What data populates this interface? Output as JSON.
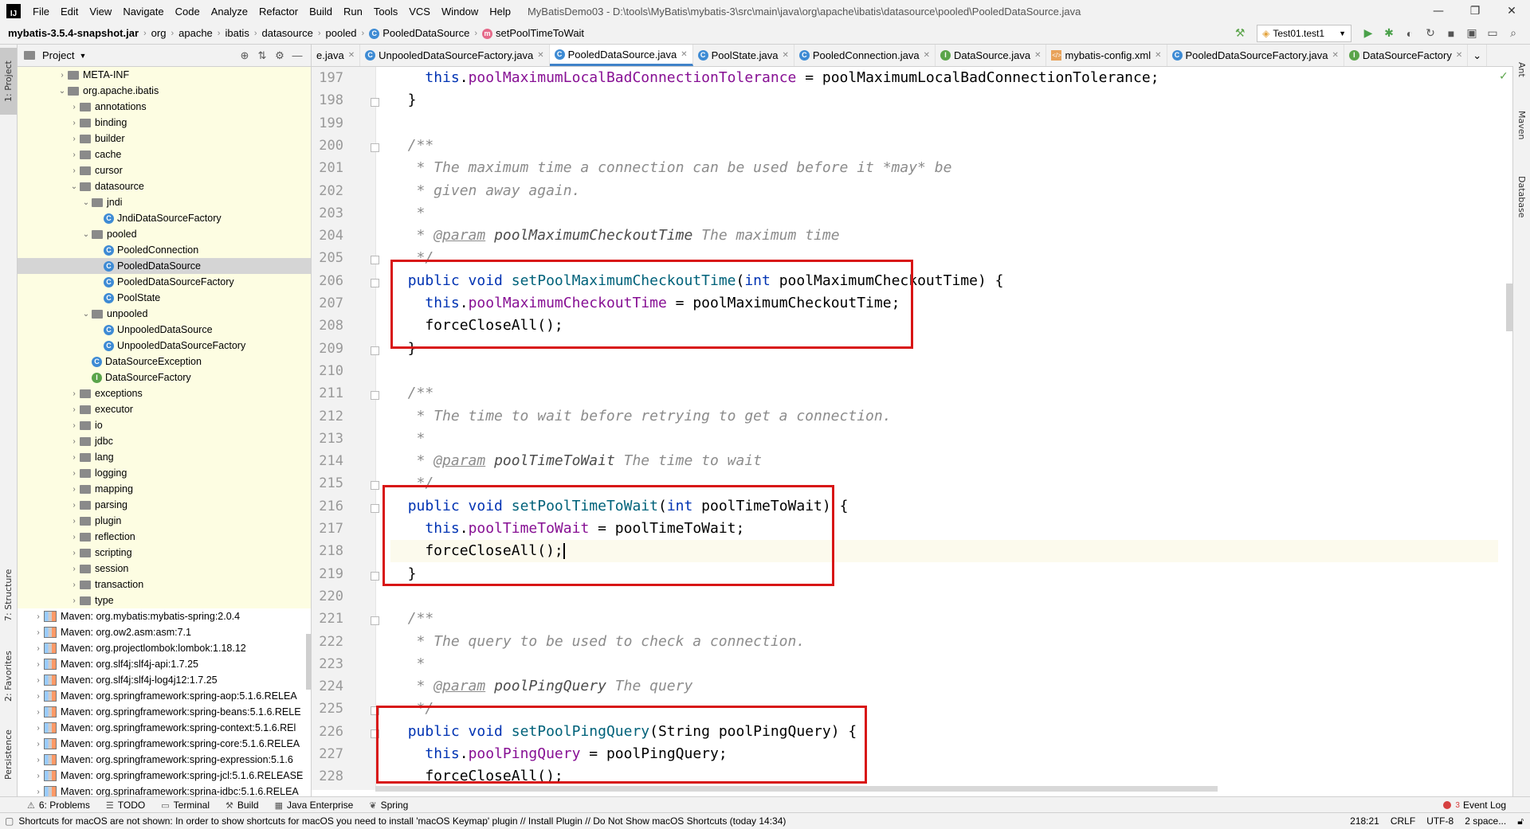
{
  "menubar": {
    "logo": "IJ",
    "items": [
      "File",
      "Edit",
      "View",
      "Navigate",
      "Code",
      "Analyze",
      "Refactor",
      "Build",
      "Run",
      "Tools",
      "VCS",
      "Window",
      "Help"
    ],
    "title": "MyBatisDemo03 - D:\\tools\\MyBatis\\mybatis-3\\src\\main\\java\\org\\apache\\ibatis\\datasource\\pooled\\PooledDataSource.java"
  },
  "breadcrumb": {
    "items": [
      "mybatis-3.5.4-snapshot.jar",
      "org",
      "apache",
      "ibatis",
      "datasource",
      "pooled",
      "PooledDataSource",
      "setPoolTimeToWait"
    ]
  },
  "run_config": {
    "label": "Test01.test1"
  },
  "stripes": {
    "left": [
      "1: Project",
      "7: Structure",
      "2: Favorites",
      "Persistence"
    ],
    "right": [
      "Ant",
      "Maven",
      "Database"
    ]
  },
  "project_panel": {
    "title": "Project",
    "tree": [
      {
        "label": "META-INF",
        "depth": 3,
        "icon": "folder",
        "arrow": "›"
      },
      {
        "label": "org.apache.ibatis",
        "depth": 3,
        "icon": "folder",
        "arrow": "⌄"
      },
      {
        "label": "annotations",
        "depth": 4,
        "icon": "folder",
        "arrow": "›"
      },
      {
        "label": "binding",
        "depth": 4,
        "icon": "folder",
        "arrow": "›"
      },
      {
        "label": "builder",
        "depth": 4,
        "icon": "folder",
        "arrow": "›"
      },
      {
        "label": "cache",
        "depth": 4,
        "icon": "folder",
        "arrow": "›"
      },
      {
        "label": "cursor",
        "depth": 4,
        "icon": "folder",
        "arrow": "›"
      },
      {
        "label": "datasource",
        "depth": 4,
        "icon": "folder",
        "arrow": "⌄"
      },
      {
        "label": "jndi",
        "depth": 5,
        "icon": "folder",
        "arrow": "⌄"
      },
      {
        "label": "JndiDataSourceFactory",
        "depth": 6,
        "icon": "class",
        "arrow": ""
      },
      {
        "label": "pooled",
        "depth": 5,
        "icon": "folder",
        "arrow": "⌄"
      },
      {
        "label": "PooledConnection",
        "depth": 6,
        "icon": "class",
        "arrow": ""
      },
      {
        "label": "PooledDataSource",
        "depth": 6,
        "icon": "class",
        "arrow": "",
        "selected": true
      },
      {
        "label": "PooledDataSourceFactory",
        "depth": 6,
        "icon": "class",
        "arrow": ""
      },
      {
        "label": "PoolState",
        "depth": 6,
        "icon": "class",
        "arrow": ""
      },
      {
        "label": "unpooled",
        "depth": 5,
        "icon": "folder",
        "arrow": "⌄"
      },
      {
        "label": "UnpooledDataSource",
        "depth": 6,
        "icon": "class",
        "arrow": ""
      },
      {
        "label": "UnpooledDataSourceFactory",
        "depth": 6,
        "icon": "class",
        "arrow": ""
      },
      {
        "label": "DataSourceException",
        "depth": 5,
        "icon": "class",
        "arrow": ""
      },
      {
        "label": "DataSourceFactory",
        "depth": 5,
        "icon": "interface",
        "arrow": ""
      },
      {
        "label": "exceptions",
        "depth": 4,
        "icon": "folder",
        "arrow": "›"
      },
      {
        "label": "executor",
        "depth": 4,
        "icon": "folder",
        "arrow": "›"
      },
      {
        "label": "io",
        "depth": 4,
        "icon": "folder",
        "arrow": "›"
      },
      {
        "label": "jdbc",
        "depth": 4,
        "icon": "folder",
        "arrow": "›"
      },
      {
        "label": "lang",
        "depth": 4,
        "icon": "folder",
        "arrow": "›"
      },
      {
        "label": "logging",
        "depth": 4,
        "icon": "folder",
        "arrow": "›"
      },
      {
        "label": "mapping",
        "depth": 4,
        "icon": "folder",
        "arrow": "›"
      },
      {
        "label": "parsing",
        "depth": 4,
        "icon": "folder",
        "arrow": "›"
      },
      {
        "label": "plugin",
        "depth": 4,
        "icon": "folder",
        "arrow": "›"
      },
      {
        "label": "reflection",
        "depth": 4,
        "icon": "folder",
        "arrow": "›"
      },
      {
        "label": "scripting",
        "depth": 4,
        "icon": "folder",
        "arrow": "›"
      },
      {
        "label": "session",
        "depth": 4,
        "icon": "folder",
        "arrow": "›"
      },
      {
        "label": "transaction",
        "depth": 4,
        "icon": "folder",
        "arrow": "›"
      },
      {
        "label": "type",
        "depth": 4,
        "icon": "folder",
        "arrow": "›"
      },
      {
        "label": "Maven: org.mybatis:mybatis-spring:2.0.4",
        "depth": 1,
        "icon": "lib",
        "arrow": "›",
        "plain": true
      },
      {
        "label": "Maven: org.ow2.asm:asm:7.1",
        "depth": 1,
        "icon": "lib",
        "arrow": "›",
        "plain": true
      },
      {
        "label": "Maven: org.projectlombok:lombok:1.18.12",
        "depth": 1,
        "icon": "lib",
        "arrow": "›",
        "plain": true
      },
      {
        "label": "Maven: org.slf4j:slf4j-api:1.7.25",
        "depth": 1,
        "icon": "lib",
        "arrow": "›",
        "plain": true
      },
      {
        "label": "Maven: org.slf4j:slf4j-log4j12:1.7.25",
        "depth": 1,
        "icon": "lib",
        "arrow": "›",
        "plain": true
      },
      {
        "label": "Maven: org.springframework:spring-aop:5.1.6.RELEA",
        "depth": 1,
        "icon": "lib",
        "arrow": "›",
        "plain": true
      },
      {
        "label": "Maven: org.springframework:spring-beans:5.1.6.RELE",
        "depth": 1,
        "icon": "lib",
        "arrow": "›",
        "plain": true
      },
      {
        "label": "Maven: org.springframework:spring-context:5.1.6.REl",
        "depth": 1,
        "icon": "lib",
        "arrow": "›",
        "plain": true
      },
      {
        "label": "Maven: org.springframework:spring-core:5.1.6.RELEA",
        "depth": 1,
        "icon": "lib",
        "arrow": "›",
        "plain": true
      },
      {
        "label": "Maven: org.springframework:spring-expression:5.1.6",
        "depth": 1,
        "icon": "lib",
        "arrow": "›",
        "plain": true
      },
      {
        "label": "Maven: org.springframework:spring-jcl:5.1.6.RELEASE",
        "depth": 1,
        "icon": "lib",
        "arrow": "›",
        "plain": true
      },
      {
        "label": "Maven: org.sprinaframework:sprina-idbc:5.1.6.RELEA",
        "depth": 1,
        "icon": "lib",
        "arrow": "›",
        "plain": true
      }
    ]
  },
  "editor_tabs": [
    {
      "label": "e.java",
      "icon": "none"
    },
    {
      "label": "UnpooledDataSourceFactory.java",
      "icon": "class"
    },
    {
      "label": "PooledDataSource.java",
      "icon": "class",
      "active": true
    },
    {
      "label": "PoolState.java",
      "icon": "class"
    },
    {
      "label": "PooledConnection.java",
      "icon": "class"
    },
    {
      "label": "DataSource.java",
      "icon": "interface"
    },
    {
      "label": "mybatis-config.xml",
      "icon": "xml"
    },
    {
      "label": "PooledDataSourceFactory.java",
      "icon": "class"
    },
    {
      "label": "DataSourceFactory",
      "icon": "interface"
    }
  ],
  "code": {
    "lines": [
      {
        "n": "197",
        "tokens": [
          [
            "    ",
            ""
          ],
          [
            "this",
            ".kw"
          ],
          [
            ".",
            ""
          ],
          [
            "poolMaximumLocalBadConnectionTolerance",
            "fld"
          ],
          [
            " = poolMaximumLocalBadConnectionTolerance;",
            ""
          ]
        ]
      },
      {
        "n": "198",
        "tokens": [
          [
            "  }",
            ""
          ]
        ]
      },
      {
        "n": "199",
        "tokens": []
      },
      {
        "n": "200",
        "tokens": [
          [
            "  /**",
            "cm"
          ]
        ]
      },
      {
        "n": "201",
        "tokens": [
          [
            "   * The maximum time a connection can be used before it *may* be",
            "cm"
          ]
        ]
      },
      {
        "n": "202",
        "tokens": [
          [
            "   * given away again.",
            "cm"
          ]
        ]
      },
      {
        "n": "203",
        "tokens": [
          [
            "   *",
            "cm"
          ]
        ]
      },
      {
        "n": "204",
        "tokens": [
          [
            "   * ",
            "cm"
          ],
          [
            "@param",
            "tag"
          ],
          [
            " ",
            "cm"
          ],
          [
            "poolMaximumCheckoutTime",
            "cmb"
          ],
          [
            " The maximum time",
            "cm"
          ]
        ]
      },
      {
        "n": "205",
        "tokens": [
          [
            "   */",
            "cm"
          ]
        ]
      },
      {
        "n": "206",
        "tokens": [
          [
            "  ",
            ""
          ],
          [
            "public void ",
            "kw"
          ],
          [
            "setPoolMaximumCheckoutTime",
            "fn"
          ],
          [
            "(",
            ""
          ],
          [
            "int ",
            "kw"
          ],
          [
            "poolMaximumCheckoutTime) {",
            ""
          ]
        ]
      },
      {
        "n": "207",
        "tokens": [
          [
            "    ",
            ""
          ],
          [
            "this",
            "kw"
          ],
          [
            ".",
            ""
          ],
          [
            "poolMaximumCheckoutTime",
            "fld"
          ],
          [
            " = poolMaximumCheckoutTime;",
            ""
          ]
        ]
      },
      {
        "n": "208",
        "tokens": [
          [
            "    forceCloseAll();",
            ""
          ]
        ]
      },
      {
        "n": "209",
        "tokens": [
          [
            "  }",
            ""
          ]
        ]
      },
      {
        "n": "210",
        "tokens": []
      },
      {
        "n": "211",
        "tokens": [
          [
            "  /**",
            "cm"
          ]
        ]
      },
      {
        "n": "212",
        "tokens": [
          [
            "   * The time to wait before retrying to get a connection.",
            "cm"
          ]
        ]
      },
      {
        "n": "213",
        "tokens": [
          [
            "   *",
            "cm"
          ]
        ]
      },
      {
        "n": "214",
        "tokens": [
          [
            "   * ",
            "cm"
          ],
          [
            "@param",
            "tag"
          ],
          [
            " ",
            "cm"
          ],
          [
            "poolTimeToWait",
            "cmb"
          ],
          [
            " The time to wait",
            "cm"
          ]
        ]
      },
      {
        "n": "215",
        "tokens": [
          [
            "   */",
            "cm"
          ]
        ]
      },
      {
        "n": "216",
        "tokens": [
          [
            "  ",
            ""
          ],
          [
            "public void ",
            "kw"
          ],
          [
            "setPoolTimeToWait",
            "fn"
          ],
          [
            "(",
            ""
          ],
          [
            "int ",
            "kw"
          ],
          [
            "poolTimeToWait) {",
            ""
          ]
        ]
      },
      {
        "n": "217",
        "tokens": [
          [
            "    ",
            ""
          ],
          [
            "this",
            "kw"
          ],
          [
            ".",
            ""
          ],
          [
            "poolTimeToWait",
            "fld"
          ],
          [
            " = poolTimeToWait;",
            ""
          ]
        ]
      },
      {
        "n": "218",
        "tokens": [
          [
            "    forceCloseAll();",
            ""
          ]
        ],
        "current": true
      },
      {
        "n": "219",
        "tokens": [
          [
            "  }",
            ""
          ]
        ]
      },
      {
        "n": "220",
        "tokens": []
      },
      {
        "n": "221",
        "tokens": [
          [
            "  /**",
            "cm"
          ]
        ]
      },
      {
        "n": "222",
        "tokens": [
          [
            "   * The query to be used to check a connection.",
            "cm"
          ]
        ]
      },
      {
        "n": "223",
        "tokens": [
          [
            "   *",
            "cm"
          ]
        ]
      },
      {
        "n": "224",
        "tokens": [
          [
            "   * ",
            "cm"
          ],
          [
            "@param",
            "tag"
          ],
          [
            " ",
            "cm"
          ],
          [
            "poolPingQuery",
            "cmb"
          ],
          [
            " The query",
            "cm"
          ]
        ]
      },
      {
        "n": "225",
        "tokens": [
          [
            "   */",
            "cm"
          ]
        ]
      },
      {
        "n": "226",
        "tokens": [
          [
            "  ",
            ""
          ],
          [
            "public void ",
            "kw"
          ],
          [
            "setPoolPingQuery",
            "fn"
          ],
          [
            "(String poolPingQuery) {",
            ""
          ]
        ]
      },
      {
        "n": "227",
        "tokens": [
          [
            "    ",
            ""
          ],
          [
            "this",
            "kw"
          ],
          [
            ".",
            ""
          ],
          [
            "poolPingQuery",
            "fld"
          ],
          [
            " = poolPingQuery;",
            ""
          ]
        ]
      },
      {
        "n": "228",
        "tokens": [
          [
            "    forceCloseAll();",
            ""
          ]
        ]
      }
    ]
  },
  "bottom_tools": [
    {
      "label": "6: Problems",
      "icon": "⚠"
    },
    {
      "label": "TODO",
      "icon": "☰"
    },
    {
      "label": "Terminal",
      "icon": "▭"
    },
    {
      "label": "Build",
      "icon": "⚒"
    },
    {
      "label": "Java Enterprise",
      "icon": "▦"
    },
    {
      "label": "Spring",
      "icon": "❦"
    }
  ],
  "event_log": {
    "count": "3",
    "label": "Event Log"
  },
  "status": {
    "message": "Shortcuts for macOS are not shown: In order to show shortcuts for macOS you need to install 'macOS Keymap' plugin // Install Plugin // Do Not Show macOS Shortcuts (today 14:34)",
    "position": "218:21",
    "line_sep": "CRLF",
    "encoding": "UTF-8",
    "indent": "2 space..."
  },
  "colors": {
    "keyword": "#0033b3",
    "method": "#00627a",
    "field": "#871094",
    "comment": "#8c8c8c",
    "highlight_box": "#d81515",
    "tree_highlight": "#fdfde2"
  }
}
